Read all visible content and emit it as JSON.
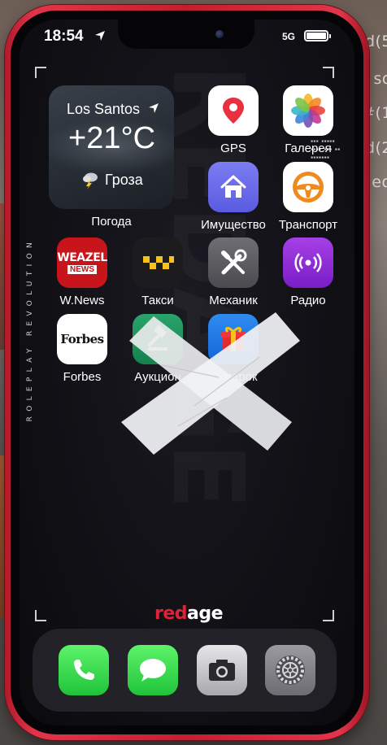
{
  "status_bar": {
    "time": "18:54",
    "network": "5G",
    "battery_level": 1.0
  },
  "weather_widget": {
    "city": "Los Santos",
    "temperature": "+21°C",
    "condition": "Гроза",
    "label": "Погода"
  },
  "side_text": "ROLEPLAY REVOLUTION",
  "apps": [
    {
      "label": "GPS",
      "icon": "map-pin-icon"
    },
    {
      "label": "Галерея",
      "icon": "photos-flower-icon"
    },
    {
      "label": "Имущество",
      "icon": "house-icon"
    },
    {
      "label": "Транспорт",
      "icon": "steering-wheel-icon"
    },
    {
      "label": "W.News",
      "icon": "weazel-news-icon"
    },
    {
      "label": "Такси",
      "icon": "taxi-icon"
    },
    {
      "label": "Механик",
      "icon": "wrench-screwdriver-icon"
    },
    {
      "label": "Радио",
      "icon": "radio-broadcast-icon"
    },
    {
      "label": "Forbes",
      "icon": "forbes-icon"
    },
    {
      "label": "Аукцион",
      "icon": "gavel-icon"
    },
    {
      "label": "Подарок",
      "icon": "gift-icon"
    }
  ],
  "icon_text": {
    "weazel": "WEAZEL",
    "weazel_news": "NEWS",
    "forbes": "Forbes"
  },
  "logo": {
    "part1": "red",
    "part2": "age"
  },
  "dock": [
    {
      "icon": "phone-icon"
    },
    {
      "icon": "messages-icon"
    },
    {
      "icon": "camera-icon"
    },
    {
      "icon": "settings-gear-icon"
    }
  ],
  "background_text": [
    "d(5",
    "so",
    "#(1",
    "d(2",
    "ed"
  ],
  "colors": {
    "frame_red": "#d9283d",
    "brand_red": "#e02239"
  }
}
